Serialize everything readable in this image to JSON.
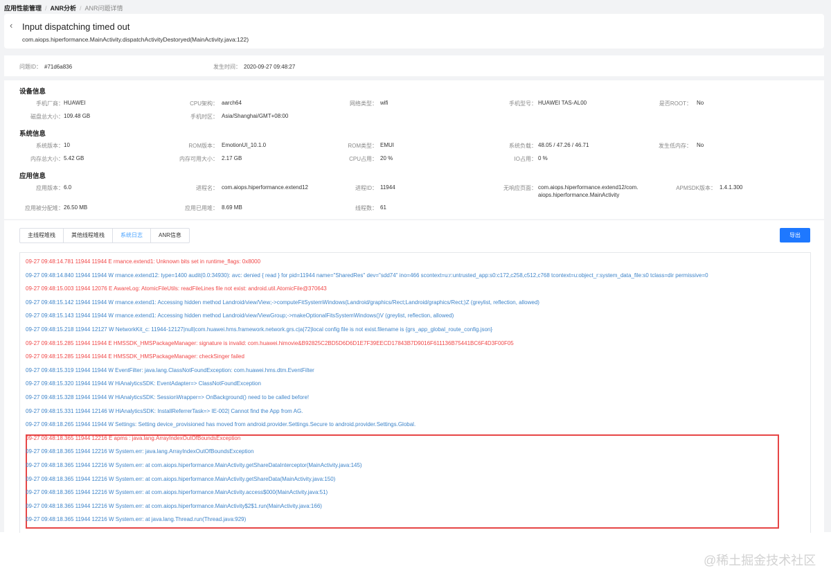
{
  "breadcrumb": [
    "应用性能管理",
    "ANR分析",
    "ANR问题详情"
  ],
  "title": "Input dispatching timed out",
  "subtitle": "com.aiops.hiperformance.MainActivity.dispatchActivityDestoryed(MainActivity.java:122)",
  "issue": {
    "id_label": "问题ID：",
    "id_value": "#71d6a836",
    "time_label": "发生时间：",
    "time_value": "2020-09-27 09:48:27"
  },
  "device": {
    "title": "设备信息",
    "fields": [
      {
        "label": "手机厂商：",
        "value": "HUAWEI"
      },
      {
        "label": "CPU架构：",
        "value": "aarch64"
      },
      {
        "label": "网络类型：",
        "value": "wifi"
      },
      {
        "label": "手机型号：",
        "value": "HUAWEI TAS-AL00"
      },
      {
        "label": "是否ROOT：",
        "value": "No"
      },
      {
        "label": "磁盘总大小：",
        "value": "109.48 GB"
      },
      {
        "label": "手机时区：",
        "value": "Asia/Shanghai/GMT+08:00"
      }
    ]
  },
  "system": {
    "title": "系统信息",
    "fields": [
      {
        "label": "系统版本：",
        "value": "10"
      },
      {
        "label": "ROM版本：",
        "value": "EmotionUI_10.1.0"
      },
      {
        "label": "ROM类型：",
        "value": "EMUI"
      },
      {
        "label": "系统负载：",
        "value": "48.05 / 47.26 / 46.71"
      },
      {
        "label": "发生低内存：",
        "value": "No"
      },
      {
        "label": "内存总大小：",
        "value": "5.42 GB"
      },
      {
        "label": "内存可用大小：",
        "value": "2.17 GB"
      },
      {
        "label": "CPU占用：",
        "value": "20 %"
      },
      {
        "label": "IO占用：",
        "value": "0 %"
      }
    ]
  },
  "app": {
    "title": "应用信息",
    "fields": [
      {
        "label": "应用版本：",
        "value": "6.0"
      },
      {
        "label": "进程名：",
        "value": "com.aiops.hiperformance.extend12"
      },
      {
        "label": "进程ID：",
        "value": "11944"
      },
      {
        "label": "无响应页面：",
        "value": "com.aiops.hiperformance.extend12/com."
      },
      {
        "label": "APMSDK版本：",
        "value": "1.4.1.300"
      },
      {
        "label": "应用被分配堆：",
        "value": "26.50 MB"
      },
      {
        "label": "应用已用堆：",
        "value": "8.69 MB"
      },
      {
        "label": "线程数：",
        "value": "61"
      }
    ],
    "page_cont": "aiops.hiperformance.MainActivity"
  },
  "tabs": [
    {
      "label": "主线程堆栈"
    },
    {
      "label": "其他线程堆栈"
    },
    {
      "label": "系统日志"
    },
    {
      "label": "ANR信息"
    }
  ],
  "active_tab": 2,
  "export_label": "导出",
  "colors": {
    "error": "#f04747",
    "warn": "#3e84c9",
    "accent": "#1e78ff",
    "highlight": "#e64545"
  },
  "logs": [
    {
      "level": "E",
      "text": "09-27 09:48:14.781 11944 11944 E rmance.extend1: Unknown bits set in runtime_flags: 0x8000"
    },
    {
      "level": "W",
      "text": "09-27 09:48:14.840 11944 11944 W rmance.extend12: type=1400 audit(0.0:34930): avc: denied { read } for pid=11944 name=\"SharedRes\" dev=\"sdd74\" ino=466 scontext=u:r:untrusted_app:s0:c172,c258,c512,c768 tcontext=u:object_r:system_data_file:s0 tclass=dir permissive=0"
    },
    {
      "level": "E",
      "text": "09-27 09:48:15.003 11944 12076 E AwareLog: AtomicFileUtils: readFileLines file not exist: android.util.AtomicFile@370643"
    },
    {
      "level": "W",
      "text": "09-27 09:48:15.142 11944 11944 W rmance.extend1: Accessing hidden method Landroid/view/View;->computeFitSystemWindows(Landroid/graphics/Rect;Landroid/graphics/Rect;)Z (greylist, reflection, allowed)"
    },
    {
      "level": "W",
      "text": "09-27 09:48:15.143 11944 11944 W rmance.extend1: Accessing hidden method Landroid/view/ViewGroup;->makeOptionalFitsSystemWindows()V (greylist, reflection, allowed)"
    },
    {
      "level": "W",
      "text": "09-27 09:48:15.218 11944 12127 W NetworkKit_c: 11944-12127|null|com.huawei.hms.framework.network.grs.c|a|72|local config file is not exist.filename is {grs_app_global_route_config.json}"
    },
    {
      "level": "E",
      "text": "09-27 09:48:15.285 11944 11944 E HMSSDK_HMSPackageManager: signature is invalid: com.huawei.himovie&B92825C2BD5D6D6D1E7F39EECD17843B7D9016F611136B75441BC6F4D3F00F05"
    },
    {
      "level": "E",
      "text": "09-27 09:48:15.285 11944 11944 E HMSSDK_HMSPackageManager: checkSinger failed"
    },
    {
      "level": "W",
      "text": "09-27 09:48:15.319 11944 11944 W EventFilter: java.lang.ClassNotFoundException: com.huawei.hms.dtm.EventFilter"
    },
    {
      "level": "W",
      "text": "09-27 09:48:15.320 11944 11944 W HiAnalyticsSDK: EventAdapter=> ClassNotFoundException"
    },
    {
      "level": "W",
      "text": "09-27 09:48:15.328 11944 11944 W HiAnalyticsSDK: SessionWrapper=> OnBackground() need to be called before!"
    },
    {
      "level": "W",
      "text": "09-27 09:48:15.331 11944 12146 W HiAnalyticsSDK: InstallReferrerTask=> IE-002| Cannot find the App from AG."
    },
    {
      "level": "W",
      "text": "09-27 09:48:18.265 11944 11944 W Settings: Setting device_provisioned has moved from android.provider.Settings.Secure to android.provider.Settings.Global."
    },
    {
      "level": "E",
      "text": "09-27 09:48:18.365 11944 12216 E apms     : java.lang.ArrayIndexOutOfBoundsException"
    },
    {
      "level": "W",
      "text": "09-27 09:48:18.365 11944 12216 W System.err: java.lang.ArrayIndexOutOfBoundsException"
    },
    {
      "level": "W",
      "text": "09-27 09:48:18.365 11944 12216 W System.err:     at com.aiops.hiperformance.MainActivity.getShareDataInterceptor(MainActivity.java:145)"
    },
    {
      "level": "W",
      "text": "09-27 09:48:18.365 11944 12216 W System.err:     at com.aiops.hiperformance.MainActivity.getShareData(MainActivity.java:150)"
    },
    {
      "level": "W",
      "text": "09-27 09:48:18.365 11944 12216 W System.err:     at com.aiops.hiperformance.MainActivity.access$000(MainActivity.java:51)"
    },
    {
      "level": "W",
      "text": "09-27 09:48:18.365 11944 12216 W System.err:     at com.aiops.hiperformance.MainActivity$2$1.run(MainActivity.java:166)"
    },
    {
      "level": "W",
      "text": "09-27 09:48:18.365 11944 12216 W System.err:     at java.lang.Thread.run(Thread.java:929)"
    }
  ],
  "watermark": "@稀土掘金技术社区"
}
